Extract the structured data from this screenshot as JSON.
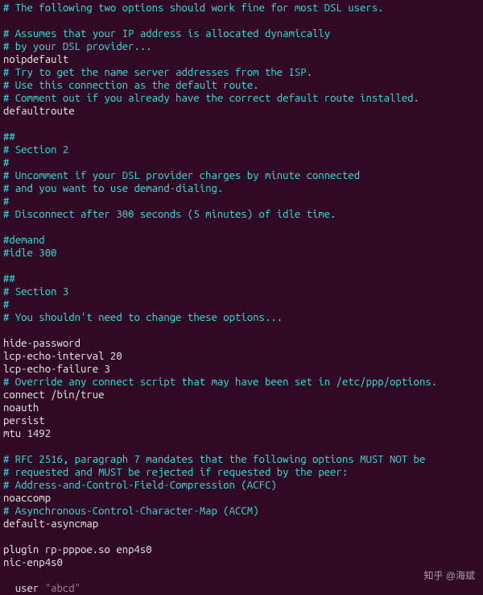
{
  "lines": [
    {
      "cls": "comment",
      "text": "# The following two options should work fine for most DSL users."
    },
    {
      "cls": "text",
      "text": ""
    },
    {
      "cls": "comment",
      "text": "# Assumes that your IP address is allocated dynamically"
    },
    {
      "cls": "comment",
      "text": "# by your DSL provider..."
    },
    {
      "cls": "text",
      "text": "noipdefault"
    },
    {
      "cls": "comment",
      "text": "# Try to get the name server addresses from the ISP."
    },
    {
      "cls": "comment",
      "text": "# Use this connection as the default route."
    },
    {
      "cls": "comment",
      "text": "# Comment out if you already have the correct default route installed."
    },
    {
      "cls": "text",
      "text": "defaultroute"
    },
    {
      "cls": "text",
      "text": ""
    },
    {
      "cls": "comment",
      "text": "##"
    },
    {
      "cls": "comment",
      "text": "# Section 2"
    },
    {
      "cls": "comment",
      "text": "#"
    },
    {
      "cls": "comment",
      "text": "# Uncomment if your DSL provider charges by minute connected"
    },
    {
      "cls": "comment",
      "text": "# and you want to use demand-dialing."
    },
    {
      "cls": "comment",
      "text": "#"
    },
    {
      "cls": "comment",
      "text": "# Disconnect after 300 seconds (5 minutes) of idle time."
    },
    {
      "cls": "text",
      "text": ""
    },
    {
      "cls": "comment",
      "text": "#demand"
    },
    {
      "cls": "comment",
      "text": "#idle 300"
    },
    {
      "cls": "text",
      "text": ""
    },
    {
      "cls": "comment",
      "text": "##"
    },
    {
      "cls": "comment",
      "text": "# Section 3"
    },
    {
      "cls": "comment",
      "text": "#"
    },
    {
      "cls": "comment",
      "text": "# You shouldn't need to change these options..."
    },
    {
      "cls": "text",
      "text": ""
    },
    {
      "cls": "text",
      "text": "hide-password"
    },
    {
      "cls": "text",
      "text": "lcp-echo-interval 20"
    },
    {
      "cls": "text",
      "text": "lcp-echo-failure 3"
    },
    {
      "cls": "comment",
      "text": "# Override any connect script that may have been set in /etc/ppp/options."
    },
    {
      "cls": "text",
      "text": "connect /bin/true"
    },
    {
      "cls": "text",
      "text": "noauth"
    },
    {
      "cls": "text",
      "text": "persist"
    },
    {
      "cls": "text",
      "text": "mtu 1492"
    },
    {
      "cls": "text",
      "text": ""
    },
    {
      "cls": "comment",
      "text": "# RFC 2516, paragraph 7 mandates that the following options MUST NOT be"
    },
    {
      "cls": "comment",
      "text": "# requested and MUST be rejected if requested by the peer:"
    },
    {
      "cls": "comment",
      "text": "# Address-and-Control-Field-Compression (ACFC)"
    },
    {
      "cls": "text",
      "text": "noaccomp"
    },
    {
      "cls": "comment",
      "text": "# Asynchronous-Control-Character-Map (ACCM)"
    },
    {
      "cls": "text",
      "text": "default-asyncmap"
    },
    {
      "cls": "text",
      "text": ""
    },
    {
      "cls": "text",
      "text": "plugin rp-pppoe.so enp4s0"
    },
    {
      "cls": "text",
      "text": "nic-enp4s0"
    }
  ],
  "user_line": {
    "prefix": "user ",
    "value": "\"abcd\""
  },
  "watermark": "知乎 @海斌"
}
